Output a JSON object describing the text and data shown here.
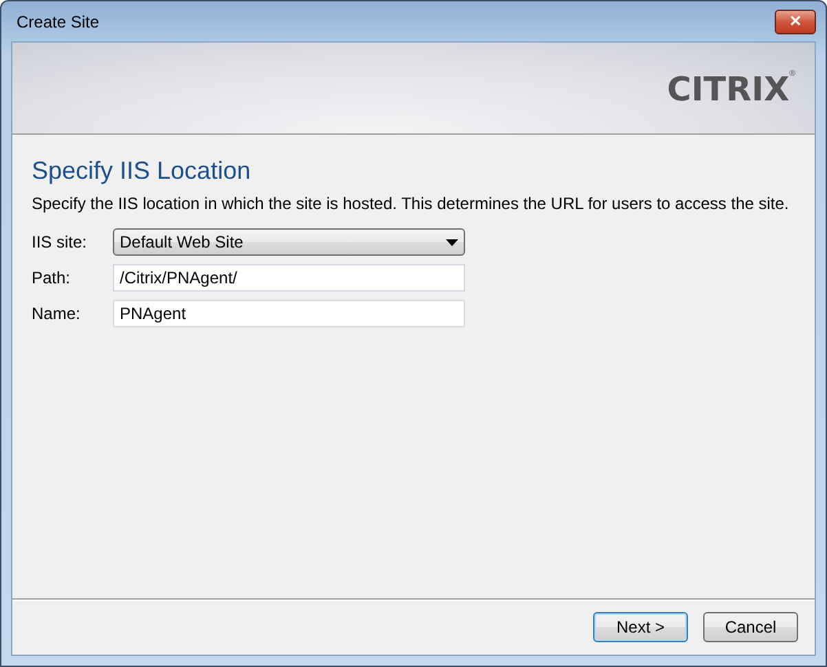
{
  "window": {
    "title": "Create Site",
    "close_label": "✕"
  },
  "banner": {
    "logo": "CITRIX",
    "logo_mark": "®"
  },
  "page": {
    "heading": "Specify IIS Location",
    "description": "Specify the IIS location in which the site is hosted. This determines the URL for users to access the site."
  },
  "fields": [
    {
      "kind": "dropdown",
      "label": "IIS site:",
      "value": "Default Web Site"
    },
    {
      "kind": "text",
      "label": "Path:",
      "value": "/Citrix/PNAgent/"
    },
    {
      "kind": "text",
      "label": "Name:",
      "value": "PNAgent"
    }
  ],
  "buttons": [
    {
      "label": "Next >",
      "default": true
    },
    {
      "label": "Cancel",
      "default": false
    }
  ]
}
